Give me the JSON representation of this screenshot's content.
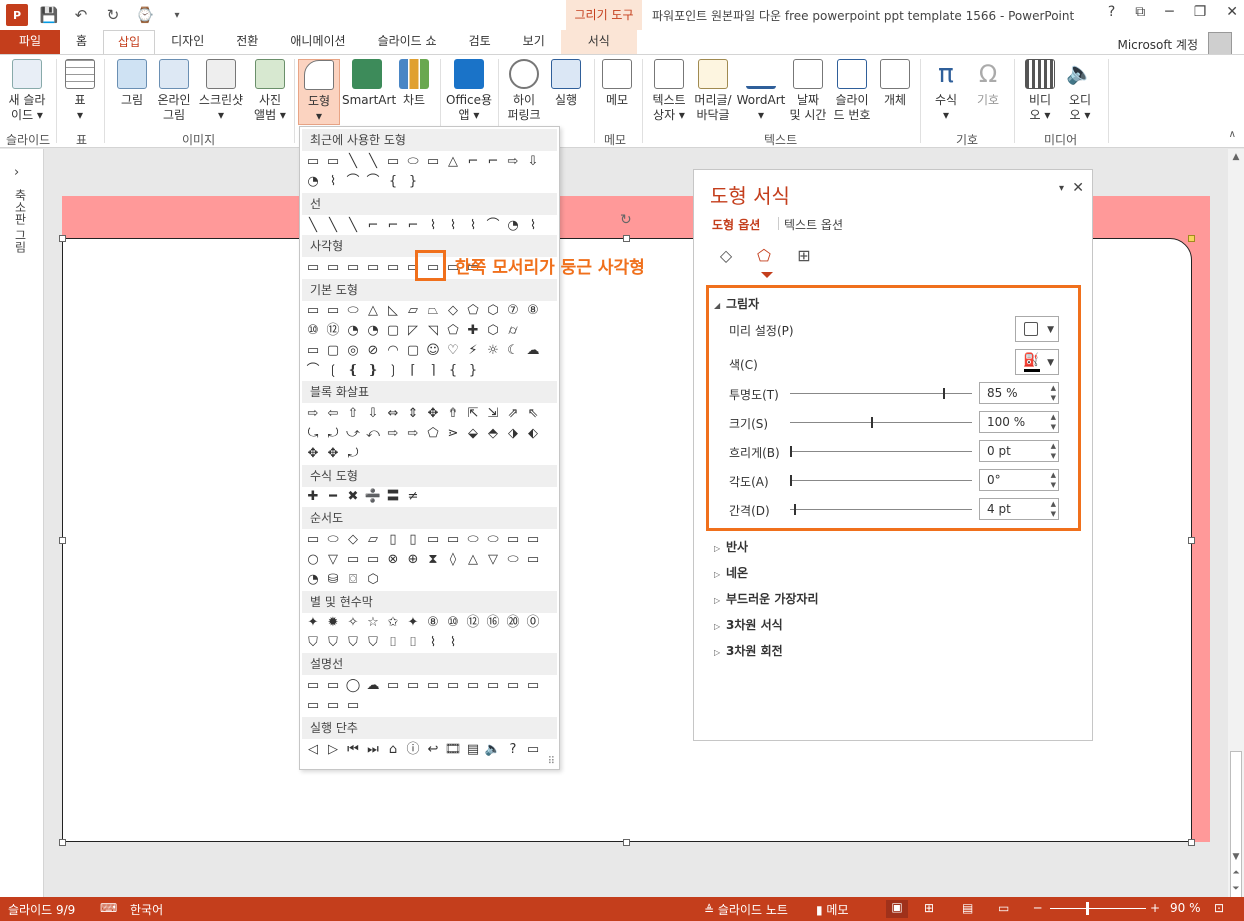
{
  "title_bar": {
    "title": "파워포인트 원본파일 다운 free powerpoint ppt template 1566 - PowerPoint",
    "contextual_group": "그리기 도구",
    "help": "?",
    "ribbon_display": "⧉",
    "minimize": "─",
    "restore": "❐",
    "close": "✕"
  },
  "tabs": [
    "파일",
    "홈",
    "삽입",
    "디자인",
    "전환",
    "애니메이션",
    "슬라이드 쇼",
    "검토",
    "보기",
    "서식"
  ],
  "account": "Microsoft 계정",
  "ribbon": {
    "new_slide": "새 슬라\n이드 ▾",
    "table": "표\n▾",
    "picture": "그림",
    "online_picture": "온라인\n그림",
    "screenshot": "스크린샷\n▾",
    "photo_album": "사진\n앨범 ▾",
    "shapes": "도형\n▾",
    "smartart": "SmartArt",
    "chart": "차트",
    "office_app": "Office용\n앱 ▾",
    "hyperlink": "하이\n퍼링크",
    "action": "실행",
    "comment": "메모",
    "textbox": "텍스트\n상자 ▾",
    "header_footer": "머리글/\n바닥글",
    "wordart": "WordArt\n▾",
    "date_time": "날짜\n및 시간",
    "slide_number": "슬라이\n드 번호",
    "object": "개체",
    "equation": "수식\n▾",
    "symbol": "기호",
    "video": "비디\n오 ▾",
    "audio": "오디\n오 ▾",
    "groups": {
      "slides": "슬라이드",
      "tables": "표",
      "images": "이미지",
      "comments": "메모",
      "text": "텍스트",
      "symbols": "기호",
      "media": "미디어"
    }
  },
  "thumb_panel": {
    "label": "축소판 그림",
    "expand": "›"
  },
  "shapes_menu": {
    "sections": [
      "최근에 사용한 도형",
      "선",
      "사각형",
      "기본 도형",
      "블록 화살표",
      "수식 도형",
      "순서도",
      "별 및 현수막",
      "설명선",
      "실행 단추"
    ],
    "rows": [
      "▭▭╲╲▭⬭▭△⌐⌐⇨⇩",
      "◔⌇⌒⌒{}",
      "╲╲╲⌐⌐⌐⌇⌇⌇⌒◔⌇",
      "▭▭▭▭▭▭▭▭▭",
      "▭▭⬭△◺▱⏢◇⬠⬡⑦⑧",
      "⑩⑫◔◔▢◸◹⬠✚⬡⌭",
      "▭▢◎⊘◠▢☺♡⚡☼☾☁",
      "⌒❲❴❵❳⌈⌉{}",
      "⇨⇦⇧⇩⇔⇕✥⇮⇱⇲⇗⇖",
      "⤿⤾⤻⤺⇨⇨⬠⋗⬙⬘⬗⬖",
      "✥✥⤾",
      "✚━✖➗〓≠",
      "▭⬭◇▱▯▯▭▭⬭⬭▭▭",
      "○▽▭▭⊗⊕⧗◊△▽⬭▭",
      "◔⛁⌼⬡",
      "✦✹✧☆✩✦⑧⑩⑫⑯⑳⓪",
      "⛉⛉⛉⛉⌷⌷⌇⌇",
      "▭▭◯☁▭▭▭▭▭▭▭▭",
      "▭▭▭",
      "◁▷⏮⏭⌂ⓘ↩🎞▤🔈?▭"
    ],
    "grip": "⠿"
  },
  "callout": "한쪽 모서리가 둥근 사각형",
  "slide": {
    "rotate_handle": "↻"
  },
  "format_pane": {
    "title": "도형 서식",
    "options_btn": "▾",
    "close": "✕",
    "tab_shape": "도형 옵션",
    "tab_text": "텍스트 옵션",
    "icon_fill": "◇",
    "icon_effects": "⬠",
    "icon_size": "⊞",
    "shadow": {
      "title": "그림자",
      "preset_label": "미리 설정(P)",
      "color_label": "색(C)",
      "transparency_label": "투명도(T)",
      "transparency_value": "85 %",
      "transparency": 0.85,
      "size_label": "크기(S)",
      "size_value": "100 %",
      "size": 0.45,
      "blur_label": "흐리게(B)",
      "blur_value": "0 pt",
      "blur": 0,
      "angle_label": "각도(A)",
      "angle_value": "0°",
      "angle": 0,
      "distance_label": "간격(D)",
      "distance_value": "4 pt",
      "distance": 0.02
    },
    "sections": [
      "반사",
      "네온",
      "부드러운 가장자리",
      "3차원 서식",
      "3차원 회전"
    ]
  },
  "status": {
    "slide": "슬라이드 9/9",
    "language": "한국어",
    "notes": "슬라이드 노트",
    "comments": "메모",
    "zoom": "90 %",
    "minus": "─",
    "plus": "+",
    "fit": "⊡"
  },
  "colors": {
    "accent": "#c43e1c",
    "highlight": "#f0701c",
    "slide_bg": "#ff9999"
  }
}
